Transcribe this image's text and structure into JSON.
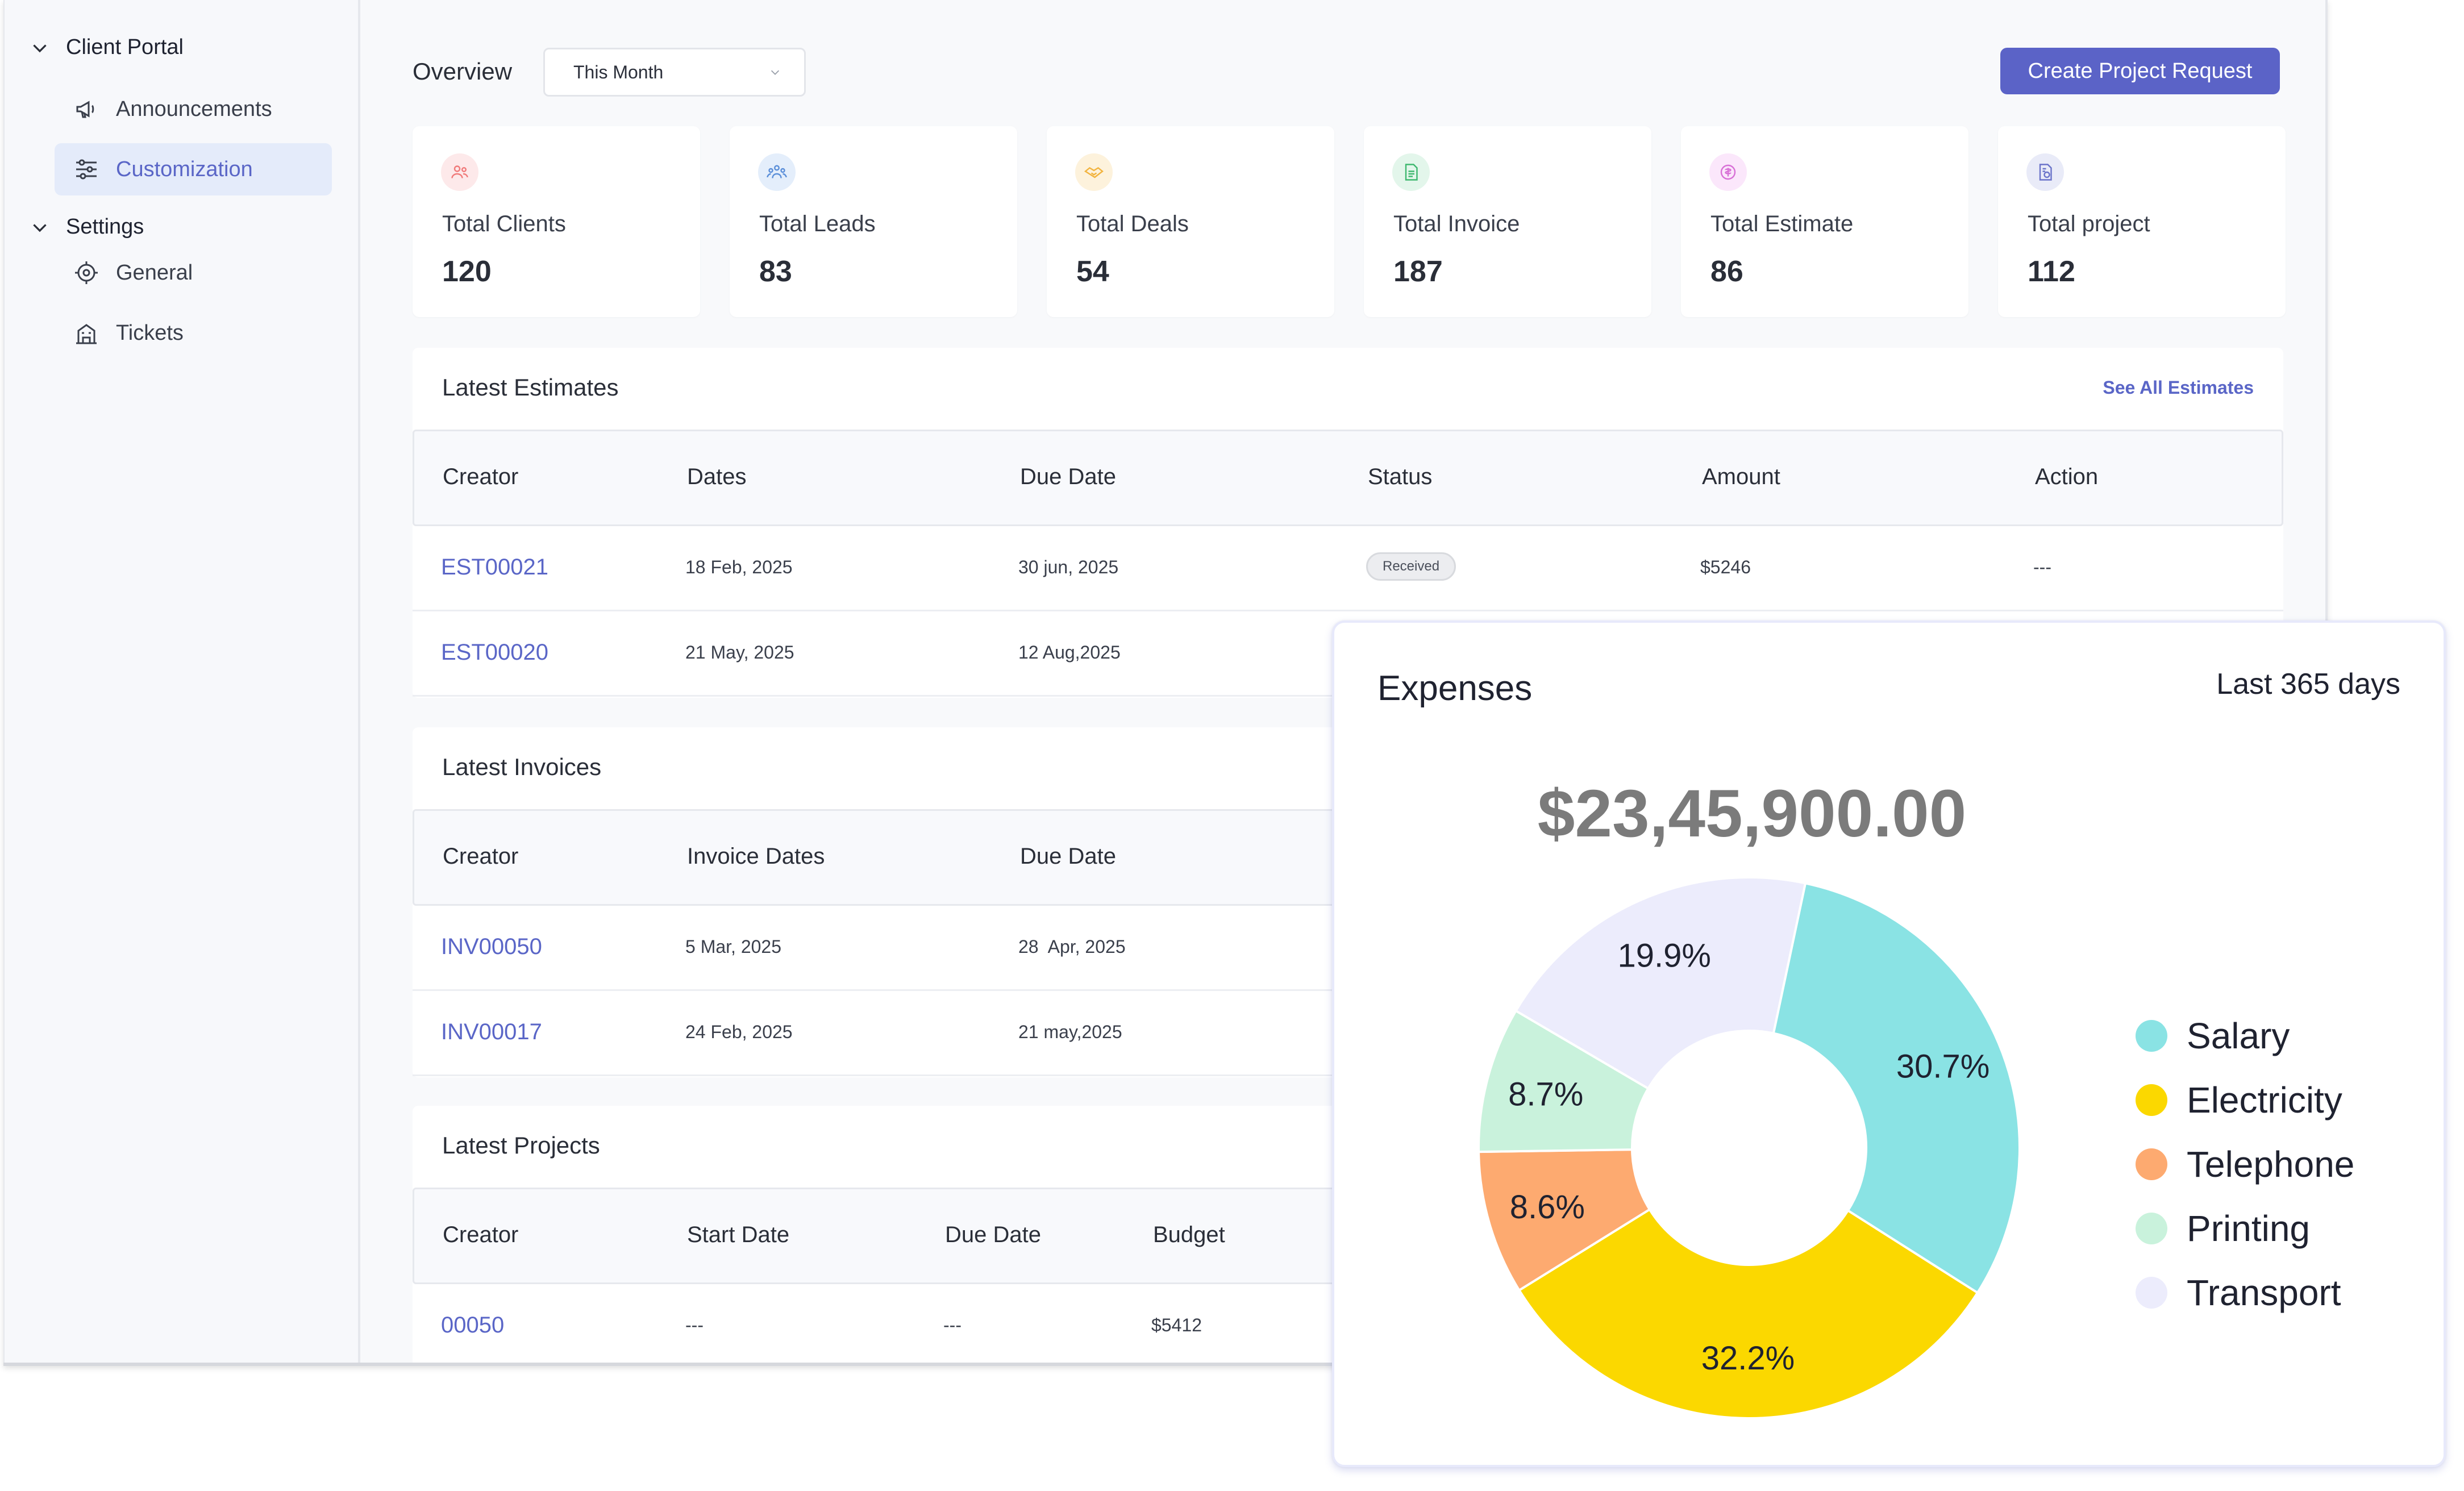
{
  "sidebar": {
    "groups": [
      {
        "label": "Client Portal",
        "items": [
          {
            "label": "Announcements"
          },
          {
            "label": "Customization",
            "active": true
          }
        ]
      },
      {
        "label": "Settings",
        "items": [
          {
            "label": "General"
          },
          {
            "label": "Tickets"
          }
        ]
      }
    ]
  },
  "header": {
    "title": "Overview",
    "period_select": "This Month",
    "create_button": "Create Project Request"
  },
  "stats": [
    {
      "label": "Total Clients",
      "value": "120",
      "icon": "clients-icon",
      "color": "#f07a7a",
      "bg": "#fde9ea"
    },
    {
      "label": "Total Leads",
      "value": "83",
      "icon": "leads-icon",
      "color": "#5b8fd9",
      "bg": "#e4eefb"
    },
    {
      "label": "Total Deals",
      "value": "54",
      "icon": "deals-icon",
      "color": "#f2b33d",
      "bg": "#fdf2dc"
    },
    {
      "label": "Total Invoice",
      "value": "187",
      "icon": "invoice-icon",
      "color": "#3fb870",
      "bg": "#e3f6eb"
    },
    {
      "label": "Total Estimate",
      "value": "86",
      "icon": "estimate-icon",
      "color": "#d870d6",
      "bg": "#fbe7fb"
    },
    {
      "label": "Total project",
      "value": "112",
      "icon": "project-icon",
      "color": "#6a73c9",
      "bg": "#e9ebf8"
    }
  ],
  "estimates": {
    "title": "Latest Estimates",
    "see_all": "See All Estimates",
    "columns": [
      "Creator",
      "Dates",
      "Due Date",
      "Status",
      "Amount",
      "Action"
    ],
    "rows": [
      {
        "creator": "EST00021",
        "date": "18 Feb, 2025",
        "due": "30 jun, 2025",
        "status": "Received",
        "amount": "$5246",
        "action": "---"
      },
      {
        "creator": "EST00020",
        "date": "21 May, 2025",
        "due": "12 Aug,2025"
      }
    ]
  },
  "invoices": {
    "title": "Latest Invoices",
    "columns": [
      "Creator",
      "Invoice Dates",
      "Due Date"
    ],
    "rows": [
      {
        "creator": "INV00050",
        "date": "5 Mar, 2025",
        "due": "28  Apr, 2025"
      },
      {
        "creator": "INV00017",
        "date": "24 Feb, 2025",
        "due": "21 may,2025"
      }
    ]
  },
  "projects": {
    "title": "Latest Projects",
    "columns": [
      "Creator",
      "Start Date",
      "Due Date",
      "Budget"
    ],
    "rows": [
      {
        "creator": "00050",
        "start": "---",
        "due": "---",
        "budget": "$5412"
      }
    ]
  },
  "expenses": {
    "title": "Expenses",
    "range": "Last 365 days",
    "total": "$23,45,900.00"
  },
  "chart_data": {
    "type": "pie",
    "donut": true,
    "categories": [
      "Salary",
      "Electricity",
      "Telephone",
      "Printing",
      "Transport"
    ],
    "values": [
      30.7,
      32.2,
      8.6,
      8.7,
      19.9
    ],
    "labels": [
      "30.7%",
      "32.2%",
      "8.6%",
      "8.7%",
      "19.9%"
    ],
    "colors": [
      "#8ae3e4",
      "#fbd800",
      "#fdaa70",
      "#c9f2dc",
      "#ececfc"
    ],
    "legend": "right"
  }
}
